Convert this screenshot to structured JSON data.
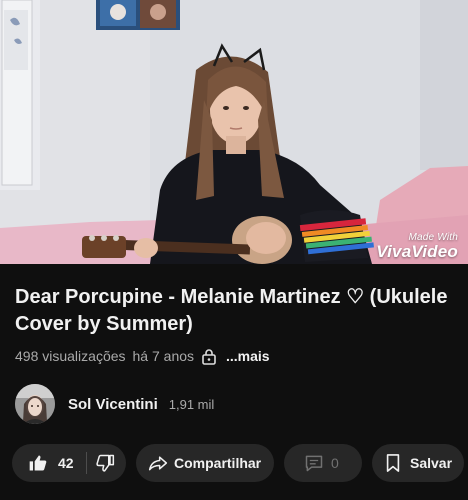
{
  "video": {
    "watermark_small": "Made With",
    "watermark_big": "VivaVideo"
  },
  "title": "Dear Porcupine - Melanie Martinez ♡ (Ukulele Cover by Summer)",
  "meta": {
    "views": "498 visualizações",
    "age": "há 7 anos",
    "more": "...mais"
  },
  "channel": {
    "name": "Sol Vicentini",
    "subscribers": "1,91 mil"
  },
  "actions": {
    "likes": "42",
    "share_label": "Compartilhar",
    "comments": "0",
    "save_label": "Salvar"
  },
  "icons": {
    "like": "thumbs-up-icon",
    "dislike": "thumbs-down-icon",
    "share": "share-arrow-icon",
    "comment": "comment-icon",
    "save": "bookmark-icon",
    "visibility": "lock-icon"
  },
  "colors": {
    "background": "#0f0f0f",
    "pill": "#272727",
    "primary_text": "#f1f1f1",
    "secondary_text": "#aaaaaa",
    "disabled_text": "#717171"
  }
}
